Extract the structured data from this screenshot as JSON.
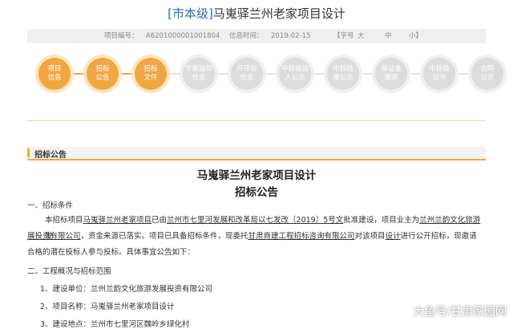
{
  "header": {
    "level": "[市本级]",
    "project_name": "马嵬驿兰州老家项目设计"
  },
  "meta": {
    "project_no_label": "项目编号：",
    "project_no": "A6201000001001804",
    "publish_date_label": "信息时间：",
    "publish_date": "2019-02-15",
    "font_label": "【字号",
    "font_large": "大",
    "font_medium": "中",
    "font_small": "小】"
  },
  "steps": [
    {
      "line1": "项目",
      "line2": "信息",
      "active": true
    },
    {
      "line1": "招标",
      "line2": "公告",
      "active": true
    },
    {
      "line1": "招标",
      "line2": "文件",
      "active": true
    },
    {
      "line1": "专家抽取",
      "line2": "信息",
      "active": false
    },
    {
      "line1": "开评标",
      "line2": "信息",
      "active": false
    },
    {
      "line1": "中标候选",
      "line2": "人公示",
      "active": false
    },
    {
      "line1": "中标结",
      "line2": "果公示",
      "active": false
    },
    {
      "line1": "保证金",
      "line2": "缴退",
      "active": false
    },
    {
      "line1": "中标吸",
      "line2": "证书",
      "active": false
    },
    {
      "line1": "合同",
      "line2": "公示",
      "active": false
    }
  ],
  "section": {
    "label": "招标公告"
  },
  "document": {
    "title_line1": "马嵬驿兰州老家项目设计",
    "title_line2": "招标公告",
    "sec1_heading": "一、招标条件",
    "para1_a": "本招标项目",
    "para1_b": "马嵬驿兰州老家项目",
    "para1_c": "已由",
    "para1_d": "兰州市七里河发展和改革局以七发改〔2019〕5号文",
    "para1_e": "批准建设，项目业主为",
    "para1_f": "兰州兰韵文化旅游发",
    "para2_a": "展投资有限公司",
    "para2_b": "，资金来源已落实。项目已具备招标条件，现委托",
    "para2_c": "甘肃商建工程招标咨询有限公司",
    "para2_d": "对该项目",
    "para2_e": "设计",
    "para2_f": "进行公开招标，现邀请",
    "para3": "合格的潜在投标人参与投标。具体事宜公告如下：",
    "sec2_heading": "二、工程概况与招标范围",
    "items": [
      "1、建设单位：兰州兰韵文化旅游发展投资有限公司",
      "2、项目名称：马嵬驿兰州老家项目设计",
      "3、建设地点：兰州市七里河区魏岭乡绿化村"
    ]
  },
  "watermark": "大鱼号/甘肃家园网",
  "colors": {
    "accent": "#f0a741",
    "accent_light": "#fde4bd",
    "inactive": "#dcdcdc",
    "title_level": "#2b6cb0"
  }
}
